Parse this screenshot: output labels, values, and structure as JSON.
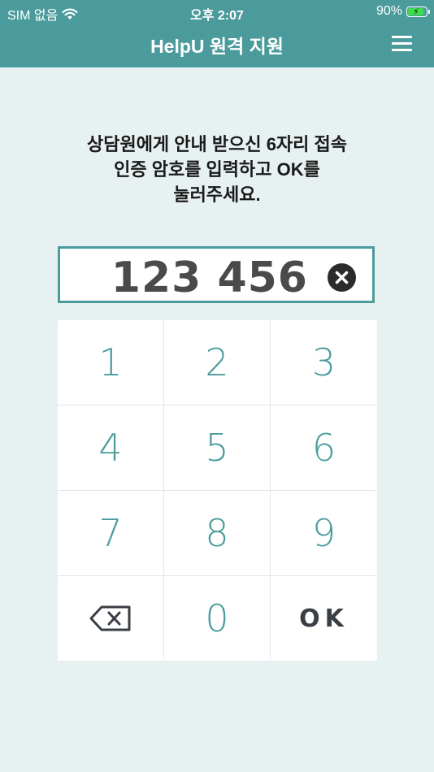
{
  "status_bar": {
    "carrier": "SIM 없음",
    "time": "오후 2:07",
    "battery_percent": "90%"
  },
  "header": {
    "title": "HelpU 원격 지원"
  },
  "instruction": {
    "line1": "상담원에게 안내 받으신 6자리 접속",
    "line2": "인증 암호를 입력하고 OK를",
    "line3": "눌러주세요."
  },
  "code_input": {
    "value": "123 456"
  },
  "keypad": {
    "keys": [
      "1",
      "2",
      "3",
      "4",
      "5",
      "6",
      "7",
      "8",
      "9"
    ],
    "zero": "0",
    "ok": "OK"
  },
  "icons": {
    "wifi": "wifi-icon",
    "battery": "battery-charging-icon",
    "menu": "hamburger-menu-icon",
    "clear": "clear-circle-x-icon",
    "backspace": "backspace-icon"
  },
  "colors": {
    "accent": "#4b9b9c",
    "background": "#e8f1f1",
    "battery_fill": "#3fdc4e"
  }
}
